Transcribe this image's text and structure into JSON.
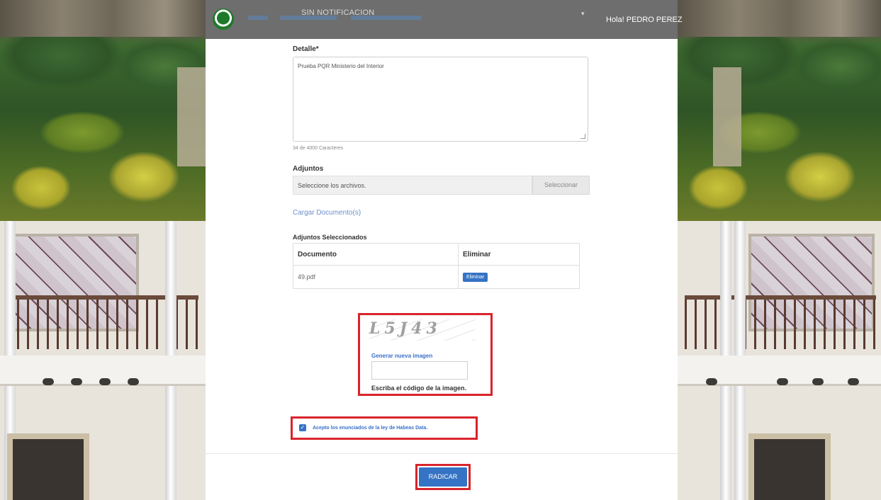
{
  "header": {
    "notification": "SIN NOTIFICACION",
    "user": "Hola! PEDRO PEREZ"
  },
  "form": {
    "detail_label": "Detalle*",
    "detail_value": "Prueba PQR Ministerio del Interior",
    "detail_counter": "34 de 4000 Caracteres",
    "attachments_label": "Adjuntos",
    "file_placeholder": "Seleccione los archivos.",
    "file_button": "Seleccionar",
    "load_link": "Cargar Documento(s)",
    "selected_label": "Adjuntos Seleccionados",
    "table": {
      "headers": [
        "Documento",
        "Eliminar"
      ],
      "rows": [
        {
          "document": "49.pdf",
          "action": "Eliminar"
        }
      ]
    },
    "captcha": {
      "code": "L5J43",
      "regenerate": "Generar nueva imagen",
      "caption": "Escriba el código de la imagen."
    },
    "accept_text": "Acepto los enunciados de la ley de Habeas Data.",
    "accept_checked": true,
    "submit": "RADICAR"
  },
  "colors": {
    "accent": "#3573c4",
    "highlight": "#d9242b",
    "header_bg": "#6e6e6e"
  }
}
